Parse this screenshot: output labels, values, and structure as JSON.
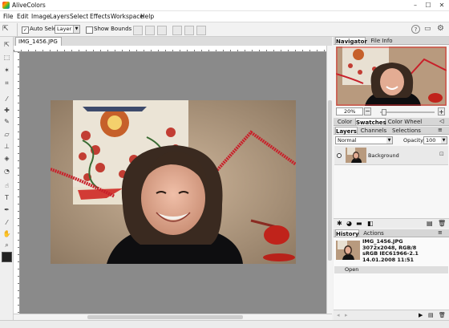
{
  "app": {
    "title": "AliveColors"
  },
  "menu": [
    "File",
    "Edit",
    "Image",
    "Layers",
    "Select",
    "Effects",
    "Workspace",
    "Help"
  ],
  "options": {
    "auto_select_label": "Auto Select",
    "auto_select_checked": true,
    "target_value": "Layer",
    "show_bounds_label": "Show Bounds",
    "show_bounds_checked": false
  },
  "document": {
    "tab_label": "IMG_1456.JPG"
  },
  "navigator": {
    "tabs": [
      "Navigator",
      "File Info"
    ],
    "active_tab": "Navigator",
    "zoom": "20%"
  },
  "color_panel": {
    "tabs": [
      "Color",
      "Swatches",
      "Color Wheel"
    ],
    "active_tab": "Swatches"
  },
  "layers_panel": {
    "tabs": [
      "Layers",
      "Channels",
      "Selections"
    ],
    "active_tab": "Layers",
    "blend_mode": "Normal",
    "opacity_label": "Opacity:",
    "opacity_value": "100",
    "layers": [
      {
        "name": "Background",
        "visible": true
      }
    ]
  },
  "history_panel": {
    "tabs": [
      "History",
      "Actions"
    ],
    "active_tab": "History",
    "snapshot": {
      "filename": "IMG_1456.JPG",
      "dimensions": "3072x2048, RGB/8",
      "profile": "sRGB IEC61966-2.1",
      "datetime": "14.01.2008 11:51"
    },
    "items": [
      "Open"
    ]
  },
  "icons": {
    "minimize": "minimize-icon",
    "maximize": "maximize-icon",
    "close": "close-icon",
    "help": "help-icon",
    "chat": "chat-icon",
    "settings": "gear-icon"
  },
  "colors": {
    "canvas_bg": "#8a8a8a",
    "foreground_swatch": "#222222",
    "background_swatch": "#f0f0f0"
  }
}
